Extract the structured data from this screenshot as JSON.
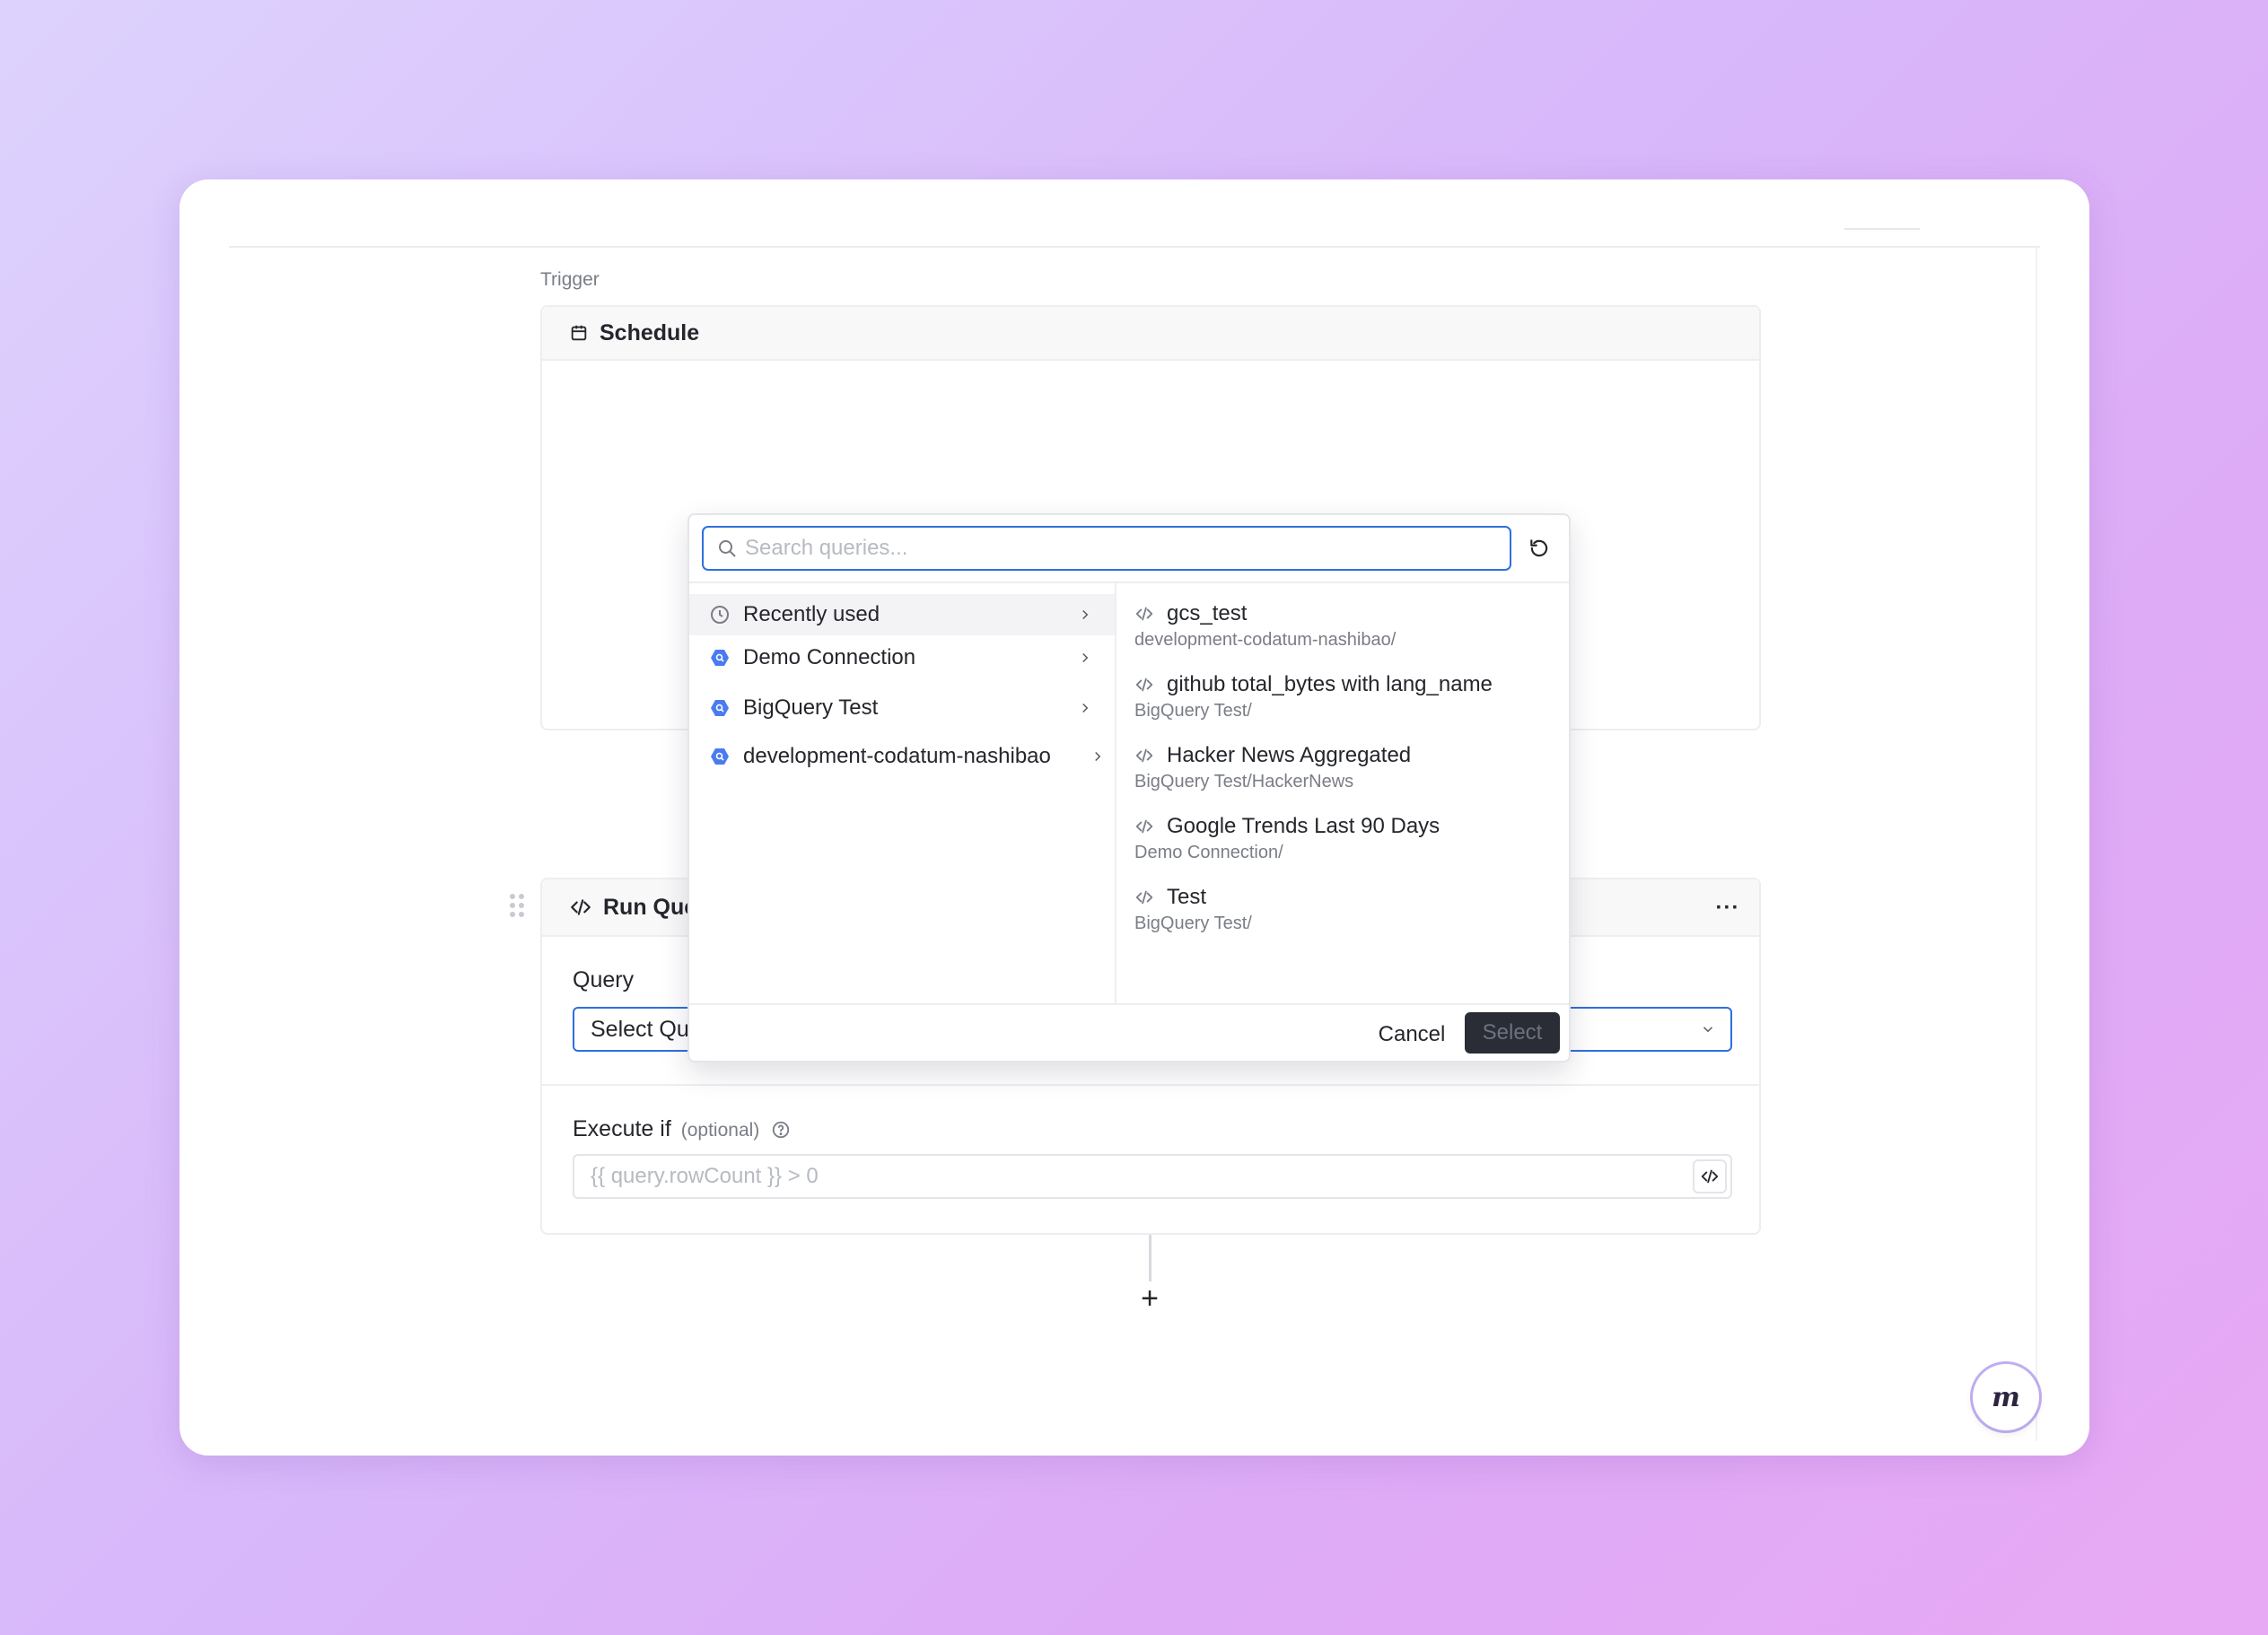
{
  "trigger": {
    "section_label": "Trigger",
    "schedule_title": "Schedule"
  },
  "query_picker": {
    "search_placeholder": "Search queries...",
    "search_value": "",
    "connections": [
      {
        "label": "Recently used",
        "icon": "clock-icon",
        "active": true
      },
      {
        "label": "Demo Connection",
        "icon": "bigquery-icon"
      },
      {
        "label": "BigQuery Test",
        "icon": "bigquery-icon"
      },
      {
        "label": "development-codatum-nashibao",
        "icon": "bigquery-icon"
      }
    ],
    "queries": [
      {
        "name": "gcs_test",
        "path": "development-codatum-nashibao/"
      },
      {
        "name": "github total_bytes with lang_name",
        "path": "BigQuery Test/"
      },
      {
        "name": "Hacker News Aggregated",
        "path": "BigQuery Test/HackerNews"
      },
      {
        "name": "Google Trends Last 90 Days",
        "path": "Demo Connection/"
      },
      {
        "name": "Test",
        "path": "BigQuery Test/"
      }
    ],
    "cancel_label": "Cancel",
    "select_label": "Select"
  },
  "run_query": {
    "title": "Run Query",
    "more_label": "···",
    "query_label": "Query",
    "select_query_label": "Select Query",
    "execute_if_label": "Execute if",
    "execute_if_optional": "(optional)",
    "execute_if_placeholder": "{{ query.rowCount }} > 0"
  },
  "add_step_label": "+",
  "brand_badge_text": "m",
  "colors": {
    "accent": "#2f6fde",
    "bigquery": "#4a7cf0",
    "select_button": "#2a2d35"
  }
}
